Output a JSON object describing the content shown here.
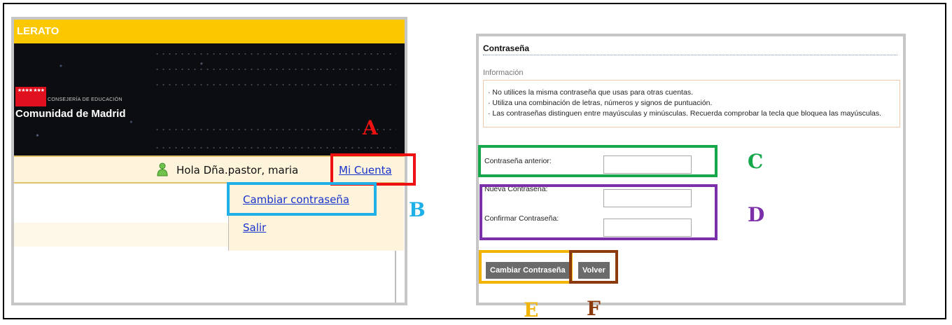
{
  "left_panel": {
    "top_strip_text": "LERATO",
    "flag_stars": "★★★★ ★★★",
    "consejeria": "CONSEJERÍA DE EDUCACIÓN",
    "comunidad": "Comunidad de Madrid",
    "greeting": "Hola Dña.pastor, maria",
    "mi_cuenta": "Mi Cuenta",
    "dropdown": {
      "cambiar": "Cambiar contraseña",
      "salir": "Salir"
    }
  },
  "right_panel": {
    "title": "Contraseña",
    "info_title": "Información",
    "info_items": [
      "No utilices la misma contraseña que usas para otras cuentas.",
      "Utiliza una combinación de letras, números y signos de puntuación.",
      "Las contraseñas distinguen entre mayúsculas y minúsculas. Recuerda comprobar la tecla que bloquea las mayúsculas."
    ],
    "fields": {
      "anterior_label": "Contraseña anterior:",
      "nueva_label": "Nueva Contraseña:",
      "confirmar_label": "Confirmar Contraseña:"
    },
    "buttons": {
      "cambiar": "Cambiar Contraseña",
      "volver": "Volver"
    }
  },
  "annotations": {
    "A": "A",
    "B": "B",
    "C": "C",
    "D": "D",
    "E": "E",
    "F": "F"
  },
  "colors": {
    "gold": "#fbc800",
    "madrid_red": "#e0101f",
    "link_blue": "#1a33cc",
    "button_gray": "#6b6b6b",
    "anno_A": "#ee1111",
    "anno_B": "#1fb0e8",
    "anno_C": "#14a84a",
    "anno_D": "#7b2fa8",
    "anno_E": "#f2b400",
    "anno_F": "#8b3a0e"
  }
}
